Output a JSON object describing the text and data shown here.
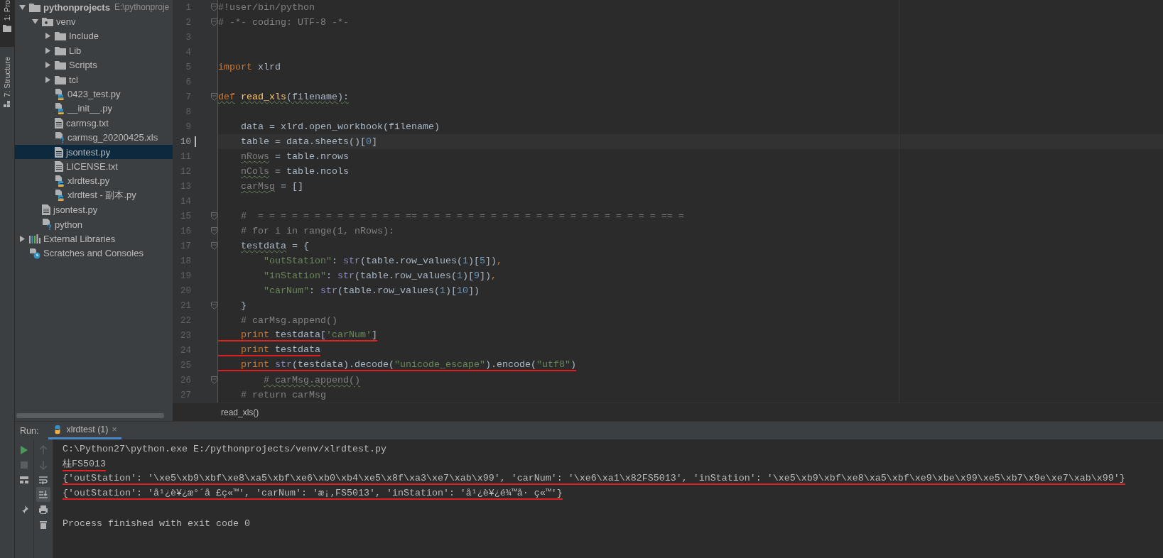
{
  "tool_strip": [
    {
      "label": "1: Pro",
      "selected": true,
      "kind": "project"
    },
    {
      "label": "7: Structure",
      "selected": false,
      "kind": "structure"
    }
  ],
  "project_tree": [
    {
      "label": "pythonprojects",
      "path": "E:\\pythonproje",
      "kind": "folder",
      "expanded": true,
      "selected": false,
      "children": [
        {
          "label": "venv",
          "kind": "venv",
          "expanded": true,
          "selected": false,
          "children": [
            {
              "label": "Include",
              "kind": "folder",
              "expanded": false,
              "selected": false
            },
            {
              "label": "Lib",
              "kind": "folder",
              "expanded": false,
              "selected": false
            },
            {
              "label": "Scripts",
              "kind": "folder",
              "expanded": false,
              "selected": false
            },
            {
              "label": "tcl",
              "kind": "folder",
              "expanded": false,
              "selected": false
            },
            {
              "label": "0423_test.py",
              "kind": "py",
              "selected": false
            },
            {
              "label": "__init__.py",
              "kind": "py",
              "selected": false
            },
            {
              "label": "carmsg.txt",
              "kind": "txt",
              "selected": false
            },
            {
              "label": "carmsg_20200425.xls",
              "kind": "unknown",
              "selected": false
            },
            {
              "label": "jsontest.py",
              "kind": "txt",
              "selected": true
            },
            {
              "label": "LICENSE.txt",
              "kind": "txt",
              "selected": false
            },
            {
              "label": "xlrdtest.py",
              "kind": "py",
              "selected": false
            },
            {
              "label": "xlrdtest - 副本.py",
              "kind": "py",
              "selected": false
            }
          ]
        },
        {
          "label": "jsontest.py",
          "kind": "txt",
          "selected": false
        },
        {
          "label": "python",
          "kind": "unknown",
          "selected": false
        }
      ]
    },
    {
      "label": "External Libraries",
      "kind": "libraries",
      "expanded": false,
      "selected": false
    },
    {
      "label": "Scratches and Consoles",
      "kind": "scratches",
      "selected": false
    }
  ],
  "editor": {
    "lines": [
      {
        "n": "1",
        "fold": true,
        "tokens": [
          {
            "kind": "comment",
            "t": "#!user/bin/python"
          }
        ]
      },
      {
        "n": "2",
        "fold": true,
        "tokens": [
          {
            "kind": "comment",
            "t": "# -*- coding: UTF-8 -*-"
          }
        ]
      },
      {
        "n": "3"
      },
      {
        "n": "4"
      },
      {
        "n": "5",
        "tokens": [
          {
            "kind": "keyword",
            "t": "import"
          },
          {
            "kind": "plain",
            "t": " xlrd"
          }
        ]
      },
      {
        "n": "6"
      },
      {
        "n": "7",
        "fold": true,
        "tokens": [
          {
            "kind": "keyword",
            "t": "def",
            "warn": true
          },
          {
            "kind": "func",
            "t": " read_xls",
            "warn": true
          },
          {
            "kind": "plain",
            "t": "(filename):",
            "warn": true
          }
        ]
      },
      {
        "n": "8"
      },
      {
        "n": "9",
        "tokens": [
          {
            "kind": "plain",
            "t": "    data = xlrd.open_workbook(filename)"
          }
        ]
      },
      {
        "n": "10",
        "current": true,
        "tokens": [
          {
            "kind": "plain",
            "t": "    table = data.sheets()["
          },
          {
            "kind": "number",
            "t": "0"
          },
          {
            "kind": "plain",
            "t": "]"
          }
        ]
      },
      {
        "n": "11",
        "tokens": [
          {
            "kind": "unused",
            "t": "    nRows",
            "warn": true
          },
          {
            "kind": "plain",
            "t": " = table.nrows"
          }
        ]
      },
      {
        "n": "12",
        "tokens": [
          {
            "kind": "unused",
            "t": "    nCols",
            "warn": true
          },
          {
            "kind": "plain",
            "t": " = table.ncols"
          }
        ]
      },
      {
        "n": "13",
        "tokens": [
          {
            "kind": "unused",
            "t": "    carMsg",
            "warn": true
          },
          {
            "kind": "plain",
            "t": " = []"
          }
        ]
      },
      {
        "n": "14"
      },
      {
        "n": "15",
        "fold": true,
        "tokens": [
          {
            "kind": "comment",
            "t": "    #  = = = = = = = = = = = = = == = = = = = = = = = = = = = = = = = = = = = == ="
          }
        ]
      },
      {
        "n": "16",
        "fold": true,
        "tokens": [
          {
            "kind": "comment",
            "t": "    # for i in range(1, nRows):"
          }
        ]
      },
      {
        "n": "17",
        "fold": true,
        "tokens": [
          {
            "kind": "plain",
            "t": "    testdata",
            "warn": true
          },
          {
            "kind": "plain",
            "t": " = {"
          }
        ]
      },
      {
        "n": "18",
        "tokens": [
          {
            "kind": "string",
            "t": "        \"outStation\""
          },
          {
            "kind": "plain",
            "t": ": "
          },
          {
            "kind": "builtin",
            "t": "str"
          },
          {
            "kind": "plain",
            "t": "(table.row_values("
          },
          {
            "kind": "number",
            "t": "1"
          },
          {
            "kind": "plain",
            "t": ")["
          },
          {
            "kind": "number",
            "t": "5"
          },
          {
            "kind": "plain",
            "t": "])"
          },
          {
            "kind": "keyword",
            "t": ","
          }
        ]
      },
      {
        "n": "19",
        "tokens": [
          {
            "kind": "string",
            "t": "        \"inStation\""
          },
          {
            "kind": "plain",
            "t": ": "
          },
          {
            "kind": "builtin",
            "t": "str"
          },
          {
            "kind": "plain",
            "t": "(table.row_values("
          },
          {
            "kind": "number",
            "t": "1"
          },
          {
            "kind": "plain",
            "t": ")["
          },
          {
            "kind": "number",
            "t": "9"
          },
          {
            "kind": "plain",
            "t": "])"
          },
          {
            "kind": "keyword",
            "t": ","
          }
        ]
      },
      {
        "n": "20",
        "tokens": [
          {
            "kind": "string",
            "t": "        \"carNum\""
          },
          {
            "kind": "plain",
            "t": ": "
          },
          {
            "kind": "builtin",
            "t": "str"
          },
          {
            "kind": "plain",
            "t": "(table.row_values("
          },
          {
            "kind": "number",
            "t": "1"
          },
          {
            "kind": "plain",
            "t": ")["
          },
          {
            "kind": "number",
            "t": "10"
          },
          {
            "kind": "plain",
            "t": "])"
          }
        ]
      },
      {
        "n": "21",
        "fold": true,
        "tokens": [
          {
            "kind": "plain",
            "t": "    }"
          }
        ]
      },
      {
        "n": "22",
        "tokens": [
          {
            "kind": "comment",
            "t": "    # carMsg.append()"
          }
        ]
      },
      {
        "n": "23",
        "annotated": true,
        "tokens": [
          {
            "kind": "keyword",
            "t": "    print"
          },
          {
            "kind": "plain",
            "t": " testdata["
          },
          {
            "kind": "string",
            "t": "'carNum'"
          },
          {
            "kind": "plain",
            "t": "]"
          }
        ]
      },
      {
        "n": "24",
        "annotated": true,
        "tokens": [
          {
            "kind": "keyword",
            "t": "    print"
          },
          {
            "kind": "plain",
            "t": " testdata"
          }
        ]
      },
      {
        "n": "25",
        "annotated": true,
        "tokens": [
          {
            "kind": "keyword",
            "t": "    print"
          },
          {
            "kind": "builtin",
            "t": " str"
          },
          {
            "kind": "plain",
            "t": "(testdata).decode("
          },
          {
            "kind": "string",
            "t": "\"unicode_escape\""
          },
          {
            "kind": "plain",
            "t": ").encode("
          },
          {
            "kind": "string",
            "t": "\"utf8\""
          },
          {
            "kind": "plain",
            "t": ")"
          }
        ]
      },
      {
        "n": "26",
        "fold": true,
        "tokens": [
          {
            "kind": "comment",
            "t": "        # carMsg.append()",
            "warn": true
          }
        ]
      },
      {
        "n": "27",
        "tokens": [
          {
            "kind": "comment",
            "t": "    # return carMsg"
          }
        ]
      }
    ],
    "breadcrumb": "read_xls()"
  },
  "run_panel": {
    "label": "Run:",
    "tabs": [
      {
        "label": "xlrdtest (1)",
        "selected": true,
        "close": "×"
      }
    ],
    "toolbar": [
      {
        "kind": "run",
        "disabled": false
      },
      {
        "kind": "up",
        "disabled": true
      },
      {
        "kind": "stop",
        "disabled": true
      },
      {
        "kind": "down",
        "disabled": true
      },
      {
        "kind": "layout",
        "disabled": false
      },
      {
        "kind": "wrap",
        "disabled": false
      },
      {
        "kind": "blank"
      },
      {
        "kind": "scroll-end",
        "disabled": false,
        "selected": true
      },
      {
        "kind": "pin",
        "disabled": false
      },
      {
        "kind": "print",
        "disabled": false
      },
      {
        "kind": "blank"
      },
      {
        "kind": "trash",
        "disabled": false
      }
    ],
    "output": [
      {
        "text": "C:\\Python27\\python.exe E:/pythonprojects/venv/xlrdtest.py",
        "annotated": false
      },
      {
        "text": "桂FS5013",
        "annotated": true
      },
      {
        "text": "{'outStation': '\\xe5\\xb9\\xbf\\xe8\\xa5\\xbf\\xe6\\xb0\\xb4\\xe5\\x8f\\xa3\\xe7\\xab\\x99', 'carNum': '\\xe6\\xa1\\x82FS5013', 'inStation': '\\xe5\\xb9\\xbf\\xe8\\xa5\\xbf\\xe9\\xbe\\x99\\xe5\\xb7\\x9e\\xe7\\xab\\x99'}",
        "annotated": true
      },
      {
        "text": "{'outStation': 'å¹¿è¥¿æ°´å £ç«™', 'carNum': 'æ¡‚FS5013', 'inStation': 'å¹¿è¥¿é¾™å· ç«™'}",
        "annotated": true
      },
      {
        "text": "Process finished with exit code 0",
        "annotated": false
      }
    ]
  }
}
